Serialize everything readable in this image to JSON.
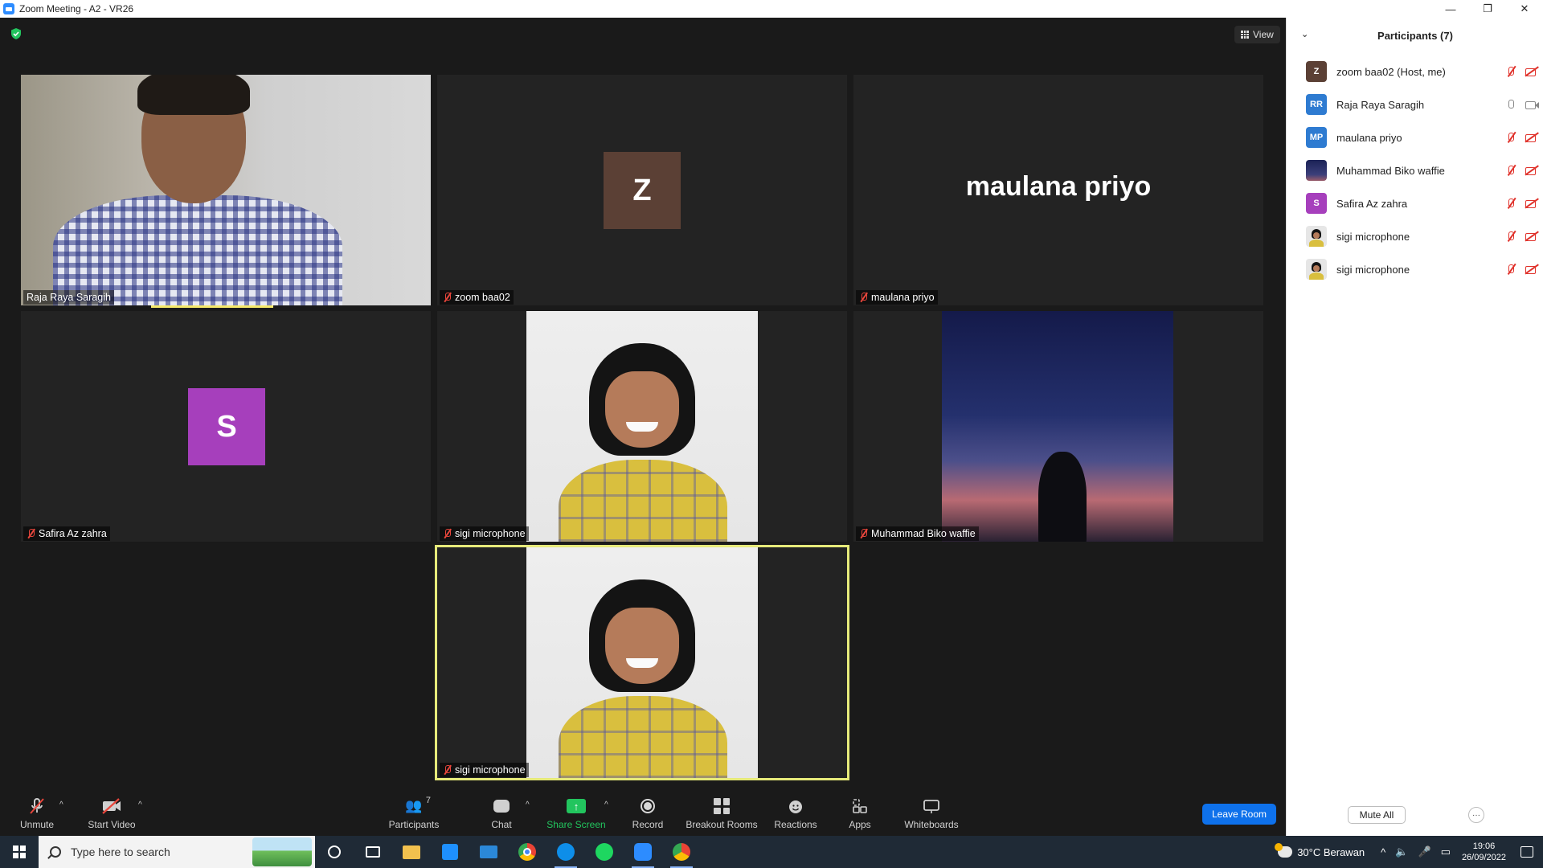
{
  "window": {
    "title": "Zoom Meeting - A2 - VR26",
    "minimize": "—",
    "restore": "❐",
    "close": "✕"
  },
  "meeting": {
    "view_label": "View",
    "tiles": [
      {
        "name": "Raja Raya Saragih",
        "type": "video-man",
        "muted": false,
        "speaking": true
      },
      {
        "name": "zoom baa02",
        "type": "avatar",
        "initial": "Z",
        "avatar_color": "#5b4035",
        "muted": true
      },
      {
        "name": "maulana priyo",
        "type": "name",
        "display_name": "maulana priyo",
        "muted": true
      },
      {
        "name": "Safira Az zahra",
        "type": "avatar",
        "initial": "S",
        "avatar_color": "#a63fbc",
        "muted": true
      },
      {
        "name": "sigi microphone",
        "type": "photo-girl",
        "muted": true
      },
      {
        "name": "Muhammad Biko waffie",
        "type": "photo-sky",
        "muted": true
      },
      {
        "name": "sigi microphone",
        "type": "photo-girl",
        "muted": true,
        "active": true
      }
    ]
  },
  "toolbar": {
    "unmute": "Unmute",
    "start_video": "Start Video",
    "participants": "Participants",
    "participants_count": "7",
    "chat": "Chat",
    "share_screen": "Share Screen",
    "record": "Record",
    "breakout_rooms": "Breakout Rooms",
    "reactions": "Reactions",
    "apps": "Apps",
    "whiteboards": "Whiteboards",
    "leave_room": "Leave Room",
    "share_color": "#22c55e",
    "leave_color": "#0e71eb"
  },
  "panel": {
    "title": "Participants (7)",
    "participants": [
      {
        "name": "zoom baa02 (Host, me)",
        "initials": "Z",
        "color": "#5b4035",
        "mic": "muted",
        "video": "off"
      },
      {
        "name": "Raja Raya Saragih",
        "initials": "RR",
        "color": "#2e7bd1",
        "mic": "on",
        "video": "on"
      },
      {
        "name": "maulana priyo",
        "initials": "MP",
        "color": "#2e7bd1",
        "mic": "muted",
        "video": "off"
      },
      {
        "name": "Muhammad Biko waffie",
        "initials": "",
        "color": "#27305e",
        "mic": "muted",
        "video": "off"
      },
      {
        "name": "Safira Az zahra",
        "initials": "S",
        "color": "#a63fbc",
        "mic": "muted",
        "video": "off"
      },
      {
        "name": "sigi microphone",
        "initials": "",
        "color": "#e6e6e6",
        "mic": "muted",
        "video": "off"
      },
      {
        "name": "sigi microphone",
        "initials": "",
        "color": "#e6e6e6",
        "mic": "muted",
        "video": "off"
      }
    ],
    "mute_all": "Mute All",
    "more": "···"
  },
  "taskbar": {
    "search_placeholder": "Type here to search",
    "weather": "30°C  Berawan",
    "time": "19:06",
    "date": "26/09/2022"
  }
}
